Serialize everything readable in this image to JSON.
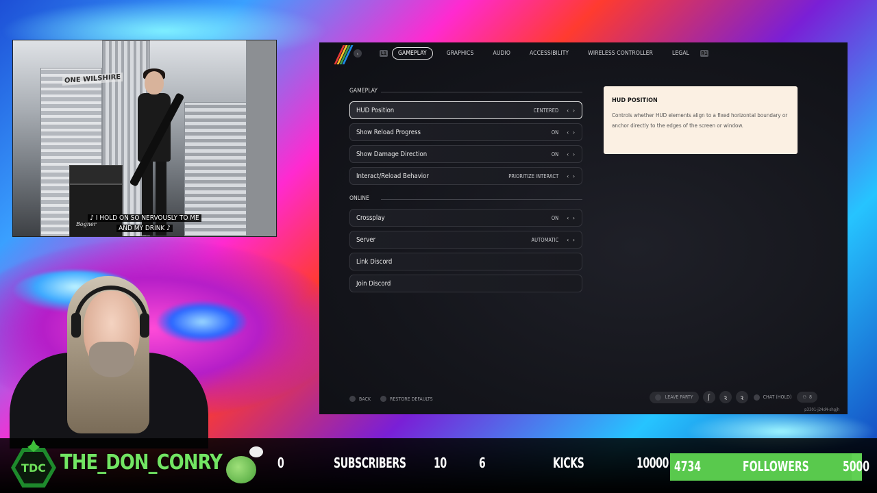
{
  "video": {
    "sign": "ONE WILSHIRE",
    "caption_line1": "♪ I HOLD ON SO NERVOUSLY TO ME",
    "caption_line2": "AND MY DRINK ♪",
    "amp_brand": "Bogner"
  },
  "game": {
    "nav": {
      "back_icon": "chevron-left-icon",
      "left_bumper": "L1",
      "right_bumper": "R1",
      "tabs": [
        {
          "label": "GAMEPLAY",
          "active": true
        },
        {
          "label": "GRAPHICS",
          "active": false
        },
        {
          "label": "AUDIO",
          "active": false
        },
        {
          "label": "ACCESSIBILITY",
          "active": false
        },
        {
          "label": "WIRELESS CONTROLLER",
          "active": false
        },
        {
          "label": "LEGAL",
          "active": false
        }
      ]
    },
    "sections": {
      "gameplay": "GAMEPLAY",
      "online": "ONLINE"
    },
    "gameplay_rows": [
      {
        "label": "HUD Position",
        "value": "CENTERED",
        "focused": true
      },
      {
        "label": "Show Reload Progress",
        "value": "ON"
      },
      {
        "label": "Show Damage Direction",
        "value": "ON"
      },
      {
        "label": "Interact/Reload Behavior",
        "value": "PRIORITIZE INTERACT"
      }
    ],
    "online_rows": [
      {
        "label": "Crossplay",
        "value": "ON"
      },
      {
        "label": "Server",
        "value": "AUTOMATIC"
      },
      {
        "label": "Link Discord",
        "value": ""
      },
      {
        "label": "Join Discord",
        "value": ""
      }
    ],
    "info": {
      "title": "HUD POSITION",
      "text": "Controls whether HUD elements align to a fixed horizontal boundary or anchor directly to the edges of the screen or window."
    },
    "footer": {
      "back": "BACK",
      "restore": "RESTORE DEFAULTS",
      "leave_party": "LEAVE PARTY",
      "chat_hold": "CHAT (HOLD)",
      "party_count": "8",
      "code": "p3301-j24d4-shgjh"
    }
  },
  "streambar": {
    "logo_text": "TDC",
    "channel": "THE_DON_CONRY",
    "subs_left": "0",
    "subscribers": "SUBSCRIBERS",
    "subs_right": "10",
    "kicks_left": "6",
    "kicks": "KICKS",
    "kicks_right": "10000",
    "followers_count": "4734",
    "followers": "FOLLOWERS",
    "followers_goal": "5000",
    "followers_progress": 0.9468
  },
  "colors": {
    "accent_green": "#72e563",
    "info_panel": "#fbf0e3",
    "bar_green": "#5fd053"
  }
}
